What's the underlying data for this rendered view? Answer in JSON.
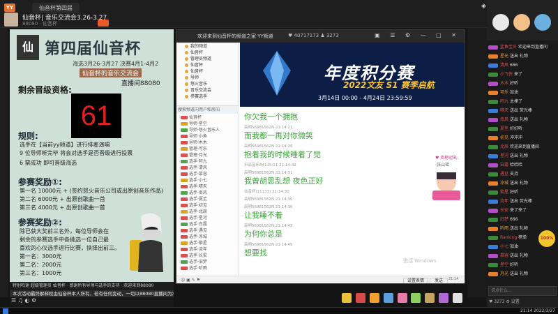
{
  "app": {
    "logo_text": "YY",
    "tabs": [
      "仙音杯第四届",
      "仙音杯第四届"
    ],
    "channel_title": "仙音杯| 音乐交流会3.26-3.27",
    "channel_sub": "88080 · 仙音杯",
    "window_controls": "— □ ✕"
  },
  "poster": {
    "logo": "仙",
    "title": "第四届仙音杯",
    "dates": "海选3月26-3月27   决赛4月1-4月2",
    "subtitle": "仙音杯的音乐交流会",
    "room": "直播间88080",
    "quali_label": "剩余晋级资格:",
    "quali_number": "61",
    "rules_heading": "规则:",
    "rule1": "选手在【当前yy频道】进行排麦演唱",
    "rule2": "9 位导师听完毕  将会对选手是否晋级进行投票",
    "rule3": "6 票成功  即可晋级海选",
    "reward1_heading": "参赛奖励①:",
    "reward1_a": "第一名  10000元 + (签约怒火音乐公司或出原创音乐作品)",
    "reward1_b": "第二名  6000元   + 出原创歌曲一首",
    "reward1_c": "第三名  4000元   + 出原创歌曲一首",
    "reward2_heading": "参赛奖励②:",
    "reward2_a": "除已获大奖前三名外，每位导师会在",
    "reward2_b": "剩余的参赛选手中各挑选一位自己最",
    "reward2_c": "喜欢的心仪选手进行比赛，抉择出前三。",
    "reward2_d": "第一名：3000元",
    "reward2_e": "第二名：2000元",
    "reward2_f": "第三名：1000元",
    "banner_scroll": "特别鸣谢 超级管理员  仙音杯 · 感谢所有导师与选手的支持 · 欢迎来到88080",
    "banner_ticker": "本次活动最终解释权由仙音杯本人所有，若有任何变动，一切以88080直播间为准"
  },
  "inner": {
    "title": "欢迎来到仙音杯的频道之家·YY频道",
    "stat": "♥ 40717173   ♟ 3273",
    "buttons": "▣ ☰ ⚙ — □ ✕",
    "tree": [
      "我的频道",
      "仙音杯",
      "管理员频道",
      "仙音杯",
      "仙音杯",
      "导师",
      "怒火音乐",
      "音乐交流会",
      "参赛选手"
    ],
    "tree_search": "搜索频道内用户和房间",
    "ad_title": "年度积分赛",
    "ad_sub": "2022文友 S1 赛季启航",
    "ad_dates": "3月14日 00:00 - 4月24日 23:59:59",
    "sidead_t1": "♥ 周榜冠名:",
    "sidead_t2": "张山瑶",
    "watermark": "激活 Windows",
    "send_label": "设置表情",
    "send2_label": "发送",
    "bottom_left": "☺ ▣ ✎ ⚑",
    "clock": "21:14"
  },
  "chat": [
    {
      "meta": "",
      "text": "你欠我一个拥抱"
    },
    {
      "meta": "高明56981562N  21:14:21",
      "text": "而我都一再对你微笑"
    },
    {
      "meta": "高明56981562N  21:14:26",
      "text": "抱着我的时候睡着了觉"
    },
    {
      "meta": "乐高音乐84115/11  21:14:32",
      "text": ""
    },
    {
      "meta": "高明56981562N  21:14:31",
      "text": "我曾胡思乱想 夜色正好"
    },
    {
      "meta": "仙音杯(11133)  21:14:30",
      "text": ""
    },
    {
      "meta": "高明56981562N  21:14:30",
      "text": ""
    },
    {
      "meta": "高明56981562N  21:14:36",
      "text": "让我睡不着"
    },
    {
      "meta": "高明56981562N  21:14:43",
      "text": "为何你总是"
    },
    {
      "meta": "高明56981562N  21:14:49",
      "text": "想要找"
    }
  ],
  "members": [
    {
      "badge": "r",
      "name": "仙音杯"
    },
    {
      "badge": "y",
      "name": "导师·星空"
    },
    {
      "badge": "g",
      "name": "导师·怒火音乐人"
    },
    {
      "badge": "r",
      "name": "导师·小鱼"
    },
    {
      "badge": "r",
      "name": "导师·木木"
    },
    {
      "badge": "y",
      "name": "管理·可乐"
    },
    {
      "badge": "r",
      "name": "管理·月光"
    },
    {
      "badge": "g",
      "name": "选手·阿九"
    },
    {
      "badge": "r",
      "name": "选手·清风"
    },
    {
      "badge": "r",
      "name": "选手·慕容"
    },
    {
      "badge": "y",
      "name": "选手·小七"
    },
    {
      "badge": "r",
      "name": "选手·晴天"
    },
    {
      "badge": "g",
      "name": "选手·南风"
    },
    {
      "badge": "r",
      "name": "选手·夏至"
    },
    {
      "badge": "r",
      "name": "选手·初见"
    },
    {
      "badge": "y",
      "name": "选手·北辰"
    },
    {
      "badge": "r",
      "name": "选手·星河"
    },
    {
      "badge": "g",
      "name": "选手·白露"
    },
    {
      "badge": "r",
      "name": "选手·遇见"
    },
    {
      "badge": "r",
      "name": "选手·凉城"
    },
    {
      "badge": "y",
      "name": "选手·繁星"
    },
    {
      "badge": "r",
      "name": "选手·流年"
    },
    {
      "badge": "r",
      "name": "选手·长安"
    },
    {
      "badge": "g",
      "name": "选手·旧梦"
    },
    {
      "badge": "r",
      "name": "选手·听雨"
    }
  ],
  "right_panel": {
    "rows": [
      {
        "lvl": "p",
        "name": "鲨鱼宝贝",
        "text": "欢迎来到直播间"
      },
      {
        "lvl": "o",
        "name": "星光",
        "text": "送出 礼物"
      },
      {
        "lvl": "b",
        "name": "清风",
        "text": "666"
      },
      {
        "lvl": "",
        "name": "小飞侠",
        "text": "来了"
      },
      {
        "lvl": "p",
        "name": "木木",
        "text": "好听"
      },
      {
        "lvl": "o",
        "name": "可乐",
        "text": "加油"
      },
      {
        "lvl": "",
        "name": "阿九",
        "text": "太棒了"
      },
      {
        "lvl": "b",
        "name": "晴天",
        "text": "送出 荧光棒"
      },
      {
        "lvl": "p",
        "name": "南风",
        "text": "送出 礼物"
      },
      {
        "lvl": "",
        "name": "夏至",
        "text": "好好听"
      },
      {
        "lvl": "o",
        "name": "初见",
        "text": "冲冲冲"
      },
      {
        "lvl": "",
        "name": "北辰",
        "text": "欢迎来到直播间"
      },
      {
        "lvl": "b",
        "name": "星河",
        "text": "送出 礼物"
      },
      {
        "lvl": "p",
        "name": "白露",
        "text": "哈哈哈"
      },
      {
        "lvl": "",
        "name": "遇见",
        "text": "支持"
      },
      {
        "lvl": "o",
        "name": "凉城",
        "text": "送出 礼物"
      },
      {
        "lvl": "",
        "name": "繁星",
        "text": "好听"
      },
      {
        "lvl": "b",
        "name": "流年",
        "text": "送出 荧光棒"
      },
      {
        "lvl": "p",
        "name": "长安",
        "text": "来了来了"
      },
      {
        "lvl": "",
        "name": "旧梦",
        "text": "666"
      },
      {
        "lvl": "o",
        "name": "听雨",
        "text": "送出 礼物"
      },
      {
        "lvl": "",
        "name": "Ranking",
        "text": "榜单"
      },
      {
        "lvl": "b",
        "name": "小七",
        "text": "加油"
      },
      {
        "lvl": "p",
        "name": "慕容",
        "text": "送出 礼物"
      },
      {
        "lvl": "",
        "name": "星空",
        "text": "好听"
      },
      {
        "lvl": "o",
        "name": "月光",
        "text": "送出 礼物"
      }
    ],
    "input_placeholder": "说点什么...",
    "bottom_text": "♥ 3273  ⚙ 设置",
    "badge": "100%"
  },
  "taskbar": {
    "clock": "21:14  2022/3/27"
  },
  "colors": {
    "accent": "#e8712a",
    "chat_green": "#3aa63a",
    "poster_bg": "#cfe0d9",
    "ad_bg": "#0c1e46"
  }
}
